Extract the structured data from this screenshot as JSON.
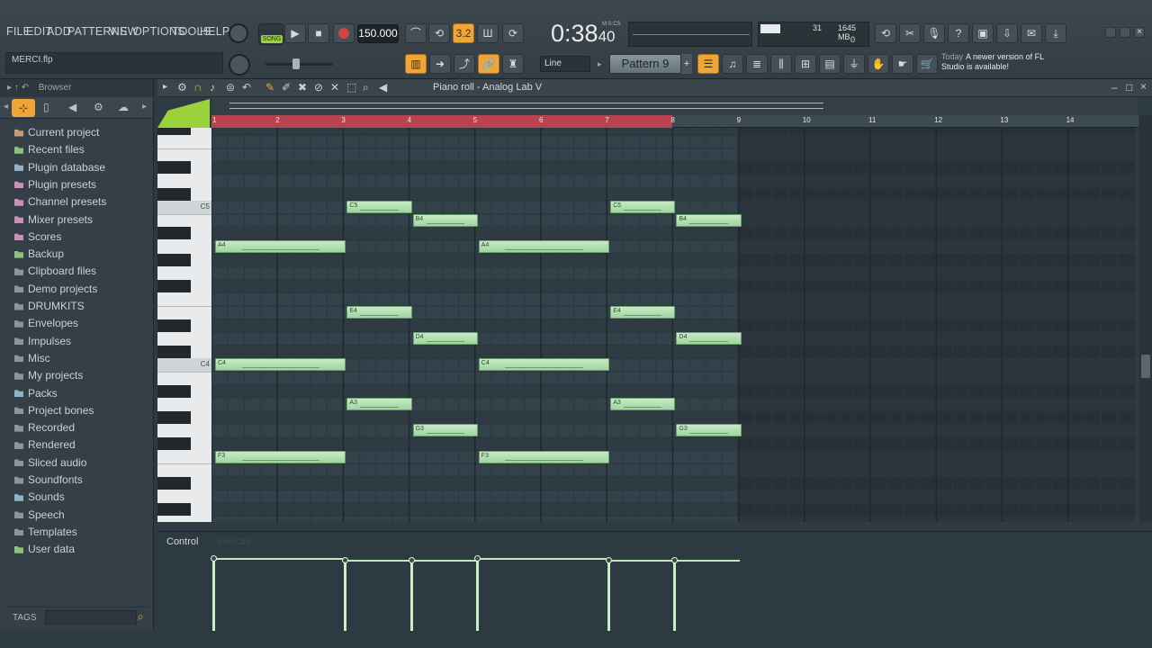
{
  "menu": [
    "FILE",
    "EDIT",
    "ADD",
    "PATTERNS",
    "VIEW",
    "OPTIONS",
    "TOOLS",
    "HELP"
  ],
  "transport": {
    "mode": "SONG",
    "tempo": "150.000",
    "time": "0:38",
    "time_small": "40",
    "time_unit": "M:S:CS"
  },
  "monitor": {
    "voices": "31",
    "memory": "1645 MB",
    "cpu": "0"
  },
  "hint": {
    "file": "MERCI.flp"
  },
  "snap": {
    "value": "Line"
  },
  "pattern": {
    "name": "Pattern 9"
  },
  "news": {
    "date": "Today",
    "text": "A newer version of FL Studio is available!"
  },
  "browser": {
    "title": "Browser",
    "items": [
      {
        "label": "Current project",
        "icon": "project-icon",
        "color": "#c79a7a"
      },
      {
        "label": "Recent files",
        "icon": "recent-folder-icon",
        "color": "#8fbf7f"
      },
      {
        "label": "Plugin database",
        "icon": "plugin-db-icon",
        "color": "#8fb2c9"
      },
      {
        "label": "Plugin presets",
        "icon": "plugin-presets-icon",
        "color": "#c98fb9"
      },
      {
        "label": "Channel presets",
        "icon": "channel-presets-icon",
        "color": "#c98fb9"
      },
      {
        "label": "Mixer presets",
        "icon": "mixer-presets-icon",
        "color": "#c98fb9"
      },
      {
        "label": "Scores",
        "icon": "scores-icon",
        "color": "#c98fb9"
      },
      {
        "label": "Backup",
        "icon": "backup-folder-icon",
        "color": "#8fbf7f"
      },
      {
        "label": "Clipboard files",
        "icon": "folder-icon",
        "color": "#8a969e"
      },
      {
        "label": "Demo projects",
        "icon": "folder-icon",
        "color": "#8a969e"
      },
      {
        "label": "DRUMKITS",
        "icon": "folder-icon",
        "color": "#8a969e"
      },
      {
        "label": "Envelopes",
        "icon": "folder-icon",
        "color": "#8a969e"
      },
      {
        "label": "Impulses",
        "icon": "folder-icon",
        "color": "#8a969e"
      },
      {
        "label": "Misc",
        "icon": "folder-icon",
        "color": "#8a969e"
      },
      {
        "label": "My projects",
        "icon": "folder-icon",
        "color": "#8a969e"
      },
      {
        "label": "Packs",
        "icon": "packs-icon",
        "color": "#8fb2c9"
      },
      {
        "label": "Project bones",
        "icon": "folder-icon",
        "color": "#8a969e"
      },
      {
        "label": "Recorded",
        "icon": "recorded-icon",
        "color": "#8a969e"
      },
      {
        "label": "Rendered",
        "icon": "rendered-icon",
        "color": "#8a969e"
      },
      {
        "label": "Sliced audio",
        "icon": "sliced-audio-icon",
        "color": "#8a969e"
      },
      {
        "label": "Soundfonts",
        "icon": "folder-icon",
        "color": "#8a969e"
      },
      {
        "label": "Sounds",
        "icon": "sounds-cloud-icon",
        "color": "#8fb2c9"
      },
      {
        "label": "Speech",
        "icon": "speech-folder-icon",
        "color": "#8a969e"
      },
      {
        "label": "Templates",
        "icon": "folder-icon",
        "color": "#8a969e"
      },
      {
        "label": "User data",
        "icon": "user-icon",
        "color": "#8fbf7f"
      }
    ],
    "tags_label": "TAGS"
  },
  "pianoroll": {
    "title": "Piano roll - Analog Lab V",
    "bars": [
      "1",
      "2",
      "3",
      "4",
      "5",
      "6",
      "7",
      "8",
      "9",
      "10",
      "11",
      "12",
      "13",
      "14"
    ],
    "key_labels": {
      "c5": "C5",
      "c4": "C4"
    },
    "control_label": "Control",
    "control_target": "Velocity",
    "notes": [
      {
        "pitch": "A4",
        "start": 1.0,
        "len": 2.0
      },
      {
        "pitch": "C4",
        "start": 1.0,
        "len": 2.0
      },
      {
        "pitch": "F3",
        "start": 1.0,
        "len": 2.0
      },
      {
        "pitch": "C5",
        "start": 3.0,
        "len": 1.0
      },
      {
        "pitch": "E4",
        "start": 3.0,
        "len": 1.0
      },
      {
        "pitch": "A3",
        "start": 3.0,
        "len": 1.0
      },
      {
        "pitch": "B4",
        "start": 4.0,
        "len": 1.0
      },
      {
        "pitch": "D4",
        "start": 4.0,
        "len": 1.0
      },
      {
        "pitch": "G3",
        "start": 4.0,
        "len": 1.0
      },
      {
        "pitch": "A4",
        "start": 5.0,
        "len": 2.0
      },
      {
        "pitch": "C4",
        "start": 5.0,
        "len": 2.0
      },
      {
        "pitch": "F3",
        "start": 5.0,
        "len": 2.0
      },
      {
        "pitch": "C5",
        "start": 7.0,
        "len": 1.0
      },
      {
        "pitch": "E4",
        "start": 7.0,
        "len": 1.0
      },
      {
        "pitch": "A3",
        "start": 7.0,
        "len": 1.0
      },
      {
        "pitch": "B4",
        "start": 8.0,
        "len": 1.0
      },
      {
        "pitch": "D4",
        "start": 8.0,
        "len": 1.0
      },
      {
        "pitch": "G3",
        "start": 8.0,
        "len": 1.0
      }
    ],
    "velocities": [
      {
        "start": 1.0,
        "len": 2.0,
        "value": 0.95
      },
      {
        "start": 3.0,
        "len": 1.0,
        "value": 0.92
      },
      {
        "start": 4.0,
        "len": 1.0,
        "value": 0.92
      },
      {
        "start": 5.0,
        "len": 2.0,
        "value": 0.95
      },
      {
        "start": 7.0,
        "len": 1.0,
        "value": 0.92
      },
      {
        "start": 8.0,
        "len": 1.0,
        "value": 0.92
      }
    ],
    "loop_end_bar": 8.0
  }
}
